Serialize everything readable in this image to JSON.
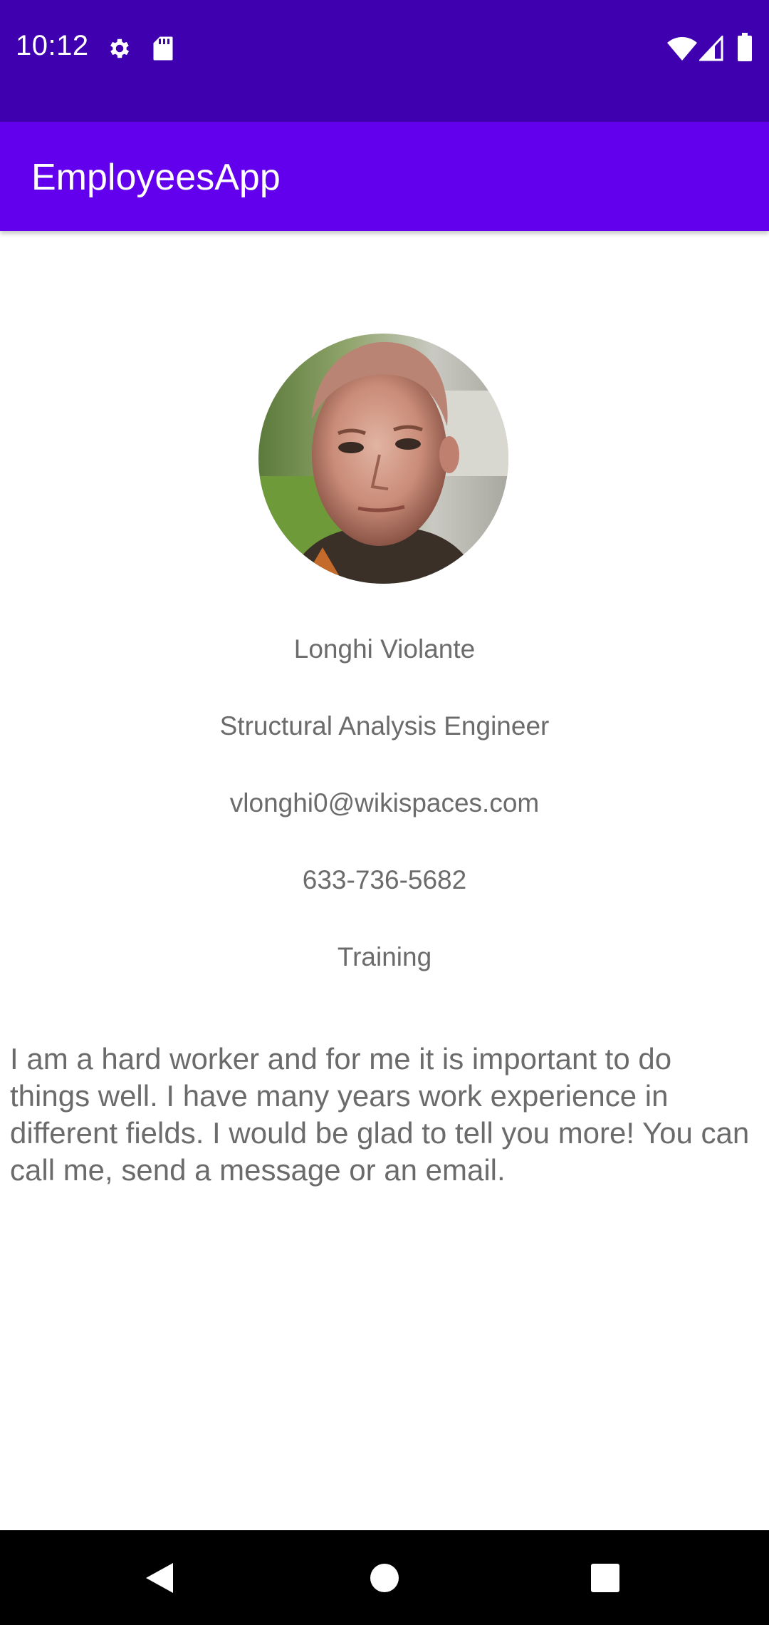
{
  "status_bar": {
    "time": "10:12",
    "icons": [
      "gear-icon",
      "sd-card-icon",
      "wifi-icon",
      "cellular-signal-icon",
      "battery-icon"
    ]
  },
  "app_bar": {
    "title": "EmployeesApp"
  },
  "employee": {
    "name": "Longhi Violante",
    "title": "Structural Analysis Engineer",
    "email": "vlonghi0@wikispaces.com",
    "phone": "633-736-5682",
    "department": "Training",
    "bio": "I am a hard worker and for me it is important to do things well. I have many years work experience in different fields. I would be glad to tell you more! You can call me, send a message or an email."
  },
  "navigation": {
    "buttons": [
      "back-icon",
      "home-icon",
      "recents-icon"
    ]
  },
  "colors": {
    "status_bar": "#3F00B0",
    "app_bar": "#6200EE",
    "text_secondary": "#6B6B6B",
    "nav_bar": "#000000"
  }
}
